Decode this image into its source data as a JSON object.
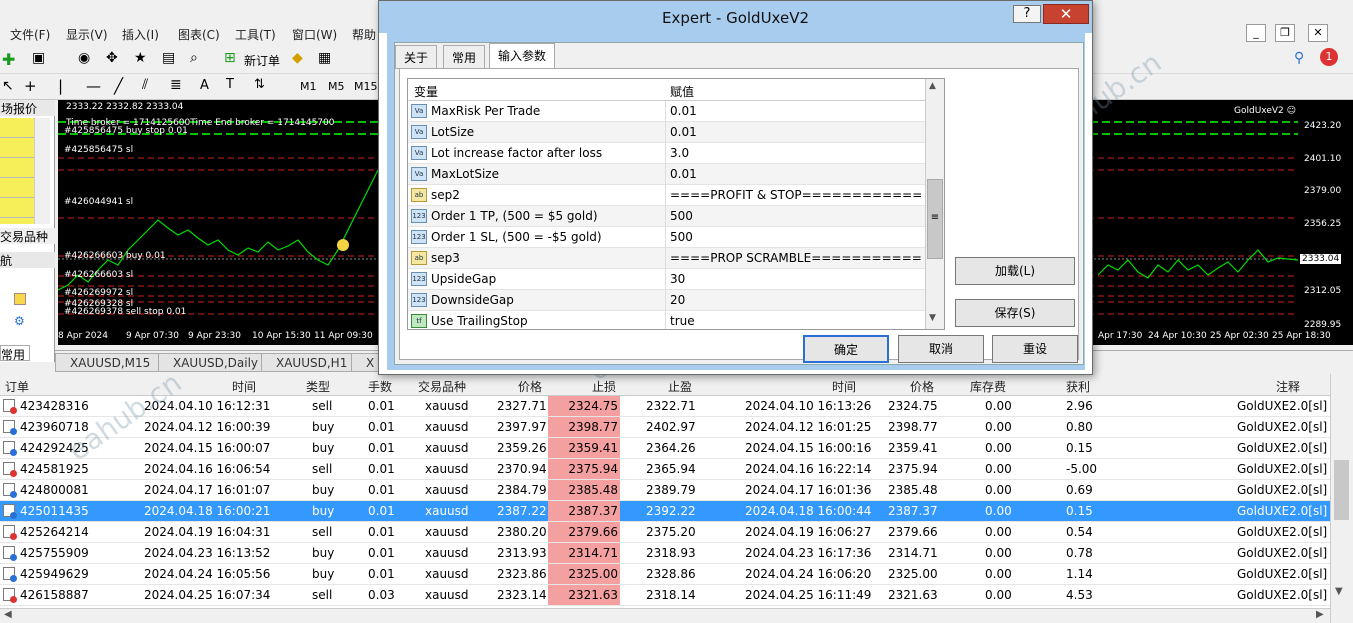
{
  "menubar": {
    "items": [
      "文件(F)",
      "显示(V)",
      "插入(I)",
      "图表(C)",
      "工具(T)",
      "窗口(W)",
      "帮助"
    ]
  },
  "toolbar": {
    "new_order": "新订单",
    "timeframes": [
      "M1",
      "M5",
      "M15"
    ]
  },
  "left_panel": {
    "market_watch": "场报价",
    "symbols_tab": "交易品种",
    "navigator": "航",
    "common_tab": "常用"
  },
  "chart": {
    "expert_label": "GoldUxeV2 ☺",
    "header_line": "2333.22 2332.82 2333.04",
    "info_line": "Time broker = 1714125600Time End broker = 1714145700",
    "order_labels": [
      "#425856475 buy stop 0.01",
      "#425856475 sl",
      "#426044941 sl",
      "#426266603 buy 0.01",
      "#426266603 sl",
      "#426269972 sl",
      "#426269328 sl",
      "#426269378 sell stop 0.01"
    ],
    "price_ticks": [
      "2423.20",
      "2401.10",
      "2379.00",
      "2356.25",
      "2333.04",
      "2312.05",
      "2289.95"
    ],
    "time_ticks_left": [
      "8 Apr 2024",
      "9 Apr 07:30",
      "9 Apr 23:30",
      "10 Apr 15:30",
      "11 Apr 09:30"
    ],
    "time_ticks_right": [
      "Apr 17:30",
      "24 Apr 10:30",
      "25 Apr 02:30",
      "25 Apr 18:30"
    ],
    "current_price": "2333.04"
  },
  "chart_tabs": [
    "XAUUSD,M15",
    "XAUUSD,Daily",
    "XAUUSD,H1",
    "X"
  ],
  "terminal": {
    "headers": [
      "订单",
      "时间",
      "类型",
      "手数",
      "交易品种",
      "价格",
      "止损",
      "止盈",
      "时间",
      "价格",
      "库存费",
      "获利",
      "注释"
    ],
    "rows": [
      [
        "423428316",
        "2024.04.10 16:12:31",
        "sell",
        "0.01",
        "xauusd",
        "2327.71",
        "2324.75",
        "2322.71",
        "2024.04.10 16:13:26",
        "2324.75",
        "0.00",
        "2.96",
        "GoldUXE2.0[sl]"
      ],
      [
        "423960718",
        "2024.04.12 16:00:39",
        "buy",
        "0.01",
        "xauusd",
        "2397.97",
        "2398.77",
        "2402.97",
        "2024.04.12 16:01:25",
        "2398.77",
        "0.00",
        "0.80",
        "GoldUXE2.0[sl]"
      ],
      [
        "424292425",
        "2024.04.15 16:00:07",
        "buy",
        "0.01",
        "xauusd",
        "2359.26",
        "2359.41",
        "2364.26",
        "2024.04.15 16:00:16",
        "2359.41",
        "0.00",
        "0.15",
        "GoldUXE2.0[sl]"
      ],
      [
        "424581925",
        "2024.04.16 16:06:54",
        "sell",
        "0.01",
        "xauusd",
        "2370.94",
        "2375.94",
        "2365.94",
        "2024.04.16 16:22:14",
        "2375.94",
        "0.00",
        "-5.00",
        "GoldUXE2.0[sl]"
      ],
      [
        "424800081",
        "2024.04.17 16:01:07",
        "buy",
        "0.01",
        "xauusd",
        "2384.79",
        "2385.48",
        "2389.79",
        "2024.04.17 16:01:36",
        "2385.48",
        "0.00",
        "0.69",
        "GoldUXE2.0[sl]"
      ],
      [
        "425011435",
        "2024.04.18 16:00:21",
        "buy",
        "0.01",
        "xauusd",
        "2387.22",
        "2387.37",
        "2392.22",
        "2024.04.18 16:00:44",
        "2387.37",
        "0.00",
        "0.15",
        "GoldUXE2.0[sl]"
      ],
      [
        "425264214",
        "2024.04.19 16:04:31",
        "sell",
        "0.01",
        "xauusd",
        "2380.20",
        "2379.66",
        "2375.20",
        "2024.04.19 16:06:27",
        "2379.66",
        "0.00",
        "0.54",
        "GoldUXE2.0[sl]"
      ],
      [
        "425755909",
        "2024.04.23 16:13:52",
        "buy",
        "0.01",
        "xauusd",
        "2313.93",
        "2314.71",
        "2318.93",
        "2024.04.23 16:17:36",
        "2314.71",
        "0.00",
        "0.78",
        "GoldUXE2.0[sl]"
      ],
      [
        "425949629",
        "2024.04.24 16:05:56",
        "buy",
        "0.01",
        "xauusd",
        "2323.86",
        "2325.00",
        "2328.86",
        "2024.04.24 16:06:20",
        "2325.00",
        "0.00",
        "1.14",
        "GoldUXE2.0[sl]"
      ],
      [
        "426158887",
        "2024.04.25 16:07:34",
        "sell",
        "0.03",
        "xauusd",
        "2323.14",
        "2321.63",
        "2318.14",
        "2024.04.25 16:11:49",
        "2321.63",
        "0.00",
        "4.53",
        "GoldUXE2.0[sl]"
      ]
    ],
    "selected_row": 5
  },
  "dialog": {
    "title": "Expert - GoldUxeV2",
    "help": "?",
    "close": "✕",
    "tabs": [
      "关于",
      "常用",
      "输入参数"
    ],
    "grid_headers": [
      "变量",
      "赋值"
    ],
    "params": [
      {
        "icon": "Va",
        "name": "MaxRisk Per Trade",
        "value": "0.01"
      },
      {
        "icon": "Va",
        "name": "LotSize",
        "value": "0.01"
      },
      {
        "icon": "Va",
        "name": "Lot increase factor after loss",
        "value": "3.0"
      },
      {
        "icon": "Va",
        "name": "MaxLotSize",
        "value": "0.01"
      },
      {
        "icon": "ab",
        "name": "sep2",
        "value": "====PROFIT & STOP============..."
      },
      {
        "icon": "123",
        "name": "Order 1 TP, (500 = $5 gold)",
        "value": "500"
      },
      {
        "icon": "123",
        "name": "Order 1 SL, (500 = -$5 gold)",
        "value": "500"
      },
      {
        "icon": "ab",
        "name": "sep3",
        "value": "====PROP SCRAMBLE============..."
      },
      {
        "icon": "123",
        "name": "UpsideGap",
        "value": "30"
      },
      {
        "icon": "123",
        "name": "DownsideGap",
        "value": "20"
      },
      {
        "icon": "tf",
        "name": "Use TrailingStop",
        "value": "true"
      }
    ],
    "load_button": "加载(L)",
    "save_button": "保存(S)",
    "ok_button": "确定",
    "cancel_button": "取消",
    "reset_button": "重设"
  },
  "watermark": "eahub.cn"
}
